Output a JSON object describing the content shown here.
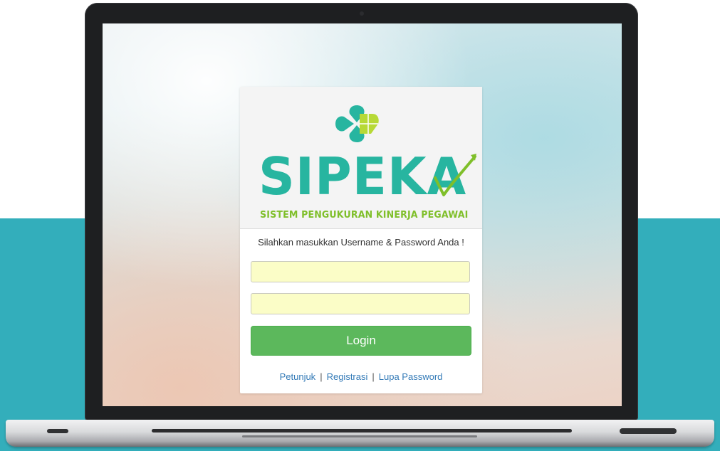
{
  "app": {
    "logo": {
      "wordmark": "SIPEKA",
      "tagline": "SISTEM PENGUKURAN KINERJA PEGAWAI"
    },
    "login": {
      "prompt": "Silahkan masukkan Username & Password Anda !",
      "username_value": "",
      "password_value": "",
      "button_label": "Login"
    },
    "links": {
      "help": "Petunjuk",
      "separator": "|",
      "register": "Registrasi",
      "forgot": "Lupa Password"
    }
  },
  "colors": {
    "teal_background": "#33aebb",
    "logo_teal": "#27b5a0",
    "logo_green": "#7fbf2a",
    "button_green": "#5cb85c",
    "input_yellow": "#fbfdc7",
    "link_blue": "#337ab7"
  },
  "icons": {
    "logo_mark": "heart-cross-icon",
    "wordmark_check": "checkmark-trend-icon"
  }
}
